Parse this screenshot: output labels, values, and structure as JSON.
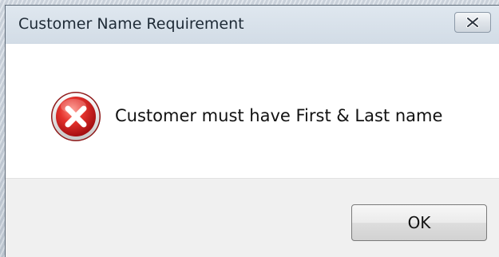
{
  "dialog": {
    "title": "Customer Name Requirement",
    "message": "Customer must have First & Last name",
    "icon": "error-icon",
    "ok_label": "OK",
    "close_icon": "close-icon"
  },
  "colors": {
    "titlebar": "#d8e1ea",
    "content_bg": "#ffffff",
    "footer_bg": "#f0f0f0",
    "error_red": "#d8262a"
  }
}
